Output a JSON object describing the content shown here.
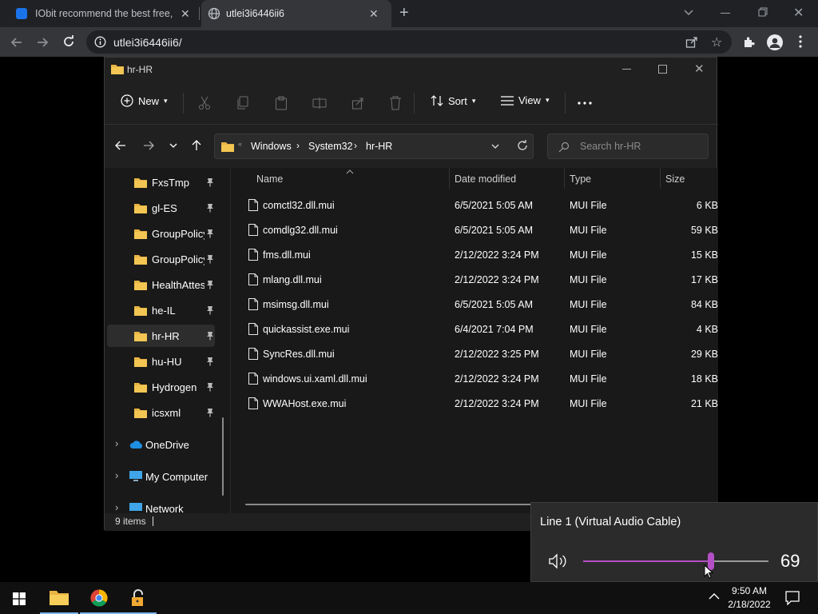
{
  "browser": {
    "tabs": [
      {
        "title": "IObit recommend the best free, f",
        "icon": "iobit-icon"
      },
      {
        "title": "utlei3i6446ii6",
        "icon": "globe-icon"
      }
    ],
    "url": "utlei3i6446ii6/"
  },
  "explorer": {
    "window_title": "hr-HR",
    "commands": {
      "new": "New",
      "sort": "Sort",
      "view": "View"
    },
    "breadcrumb": [
      "Windows",
      "System32",
      "hr-HR"
    ],
    "search_placeholder": "Search hr-HR",
    "nav_items": [
      {
        "label": "FxsTmp",
        "pinned": true
      },
      {
        "label": "gl-ES",
        "pinned": true
      },
      {
        "label": "GroupPolicy",
        "pinned": true
      },
      {
        "label": "GroupPolicy",
        "pinned": true
      },
      {
        "label": "HealthAttest",
        "pinned": true
      },
      {
        "label": "he-IL",
        "pinned": true
      },
      {
        "label": "hr-HR",
        "pinned": true,
        "selected": true
      },
      {
        "label": "hu-HU",
        "pinned": true
      },
      {
        "label": "Hydrogen",
        "pinned": true
      },
      {
        "label": "icsxml",
        "pinned": true
      }
    ],
    "nav_roots": [
      {
        "label": "OneDrive",
        "icon": "onedrive-icon"
      },
      {
        "label": "My Computer",
        "icon": "computer-icon"
      },
      {
        "label": "Network",
        "icon": "network-icon"
      }
    ],
    "columns": {
      "name": "Name",
      "date": "Date modified",
      "type": "Type",
      "size": "Size"
    },
    "files": [
      {
        "name": "comctl32.dll.mui",
        "date": "6/5/2021 5:05 AM",
        "type": "MUI File",
        "size": "6 KB"
      },
      {
        "name": "comdlg32.dll.mui",
        "date": "6/5/2021 5:05 AM",
        "type": "MUI File",
        "size": "59 KB"
      },
      {
        "name": "fms.dll.mui",
        "date": "2/12/2022 3:24 PM",
        "type": "MUI File",
        "size": "15 KB"
      },
      {
        "name": "mlang.dll.mui",
        "date": "2/12/2022 3:24 PM",
        "type": "MUI File",
        "size": "17 KB"
      },
      {
        "name": "msimsg.dll.mui",
        "date": "6/5/2021 5:05 AM",
        "type": "MUI File",
        "size": "84 KB"
      },
      {
        "name": "quickassist.exe.mui",
        "date": "6/4/2021 7:04 PM",
        "type": "MUI File",
        "size": "4 KB"
      },
      {
        "name": "SyncRes.dll.mui",
        "date": "2/12/2022 3:25 PM",
        "type": "MUI File",
        "size": "29 KB"
      },
      {
        "name": "windows.ui.xaml.dll.mui",
        "date": "2/12/2022 3:24 PM",
        "type": "MUI File",
        "size": "18 KB"
      },
      {
        "name": "WWAHost.exe.mui",
        "date": "2/12/2022 3:24 PM",
        "type": "MUI File",
        "size": "21 KB"
      }
    ],
    "status": "9 items"
  },
  "volume": {
    "device": "Line 1 (Virtual Audio Cable)",
    "level": "69",
    "level_fraction": 0.69,
    "accent": "#b44fc6"
  },
  "taskbar": {
    "time": "9:50 AM",
    "date": "2/18/2022"
  }
}
